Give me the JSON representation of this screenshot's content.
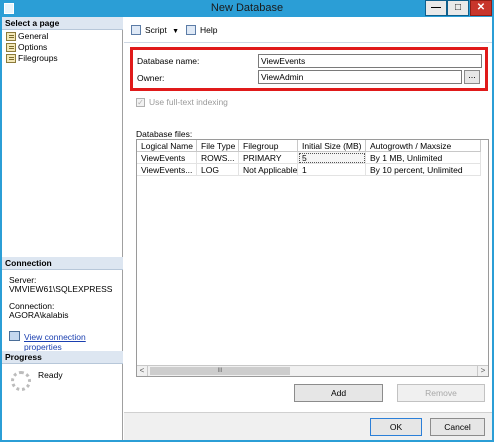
{
  "window": {
    "title": "New Database",
    "minimize_glyph": "—",
    "maximize_glyph": "□",
    "close_glyph": "✕"
  },
  "left_pane": {
    "select_page_header": "Select a page",
    "pages": [
      {
        "label": "General",
        "icon": "page-icon"
      },
      {
        "label": "Options",
        "icon": "page-icon"
      },
      {
        "label": "Filegroups",
        "icon": "page-icon"
      }
    ],
    "connection_header": "Connection",
    "server_label": "Server:",
    "server_value": "VMVIEW61\\SQLEXPRESS",
    "connection_label": "Connection:",
    "connection_value": "AGORA\\kalabis",
    "view_connection_link": "View connection properties",
    "progress_header": "Progress",
    "progress_status": "Ready"
  },
  "toolbar": {
    "script_label": "Script",
    "dropdown_arrow": "▼",
    "help_label": "Help"
  },
  "form": {
    "db_name_label": "Database name:",
    "db_name_value": "ViewEvents",
    "owner_label": "Owner:",
    "owner_value": "ViewAdmin",
    "browse_label": "...",
    "fulltext_label": "Use full-text indexing",
    "fulltext_checked": true,
    "checkmark": "✓"
  },
  "database_files": {
    "label": "Database files:",
    "columns": [
      "Logical Name",
      "File Type",
      "Filegroup",
      "Initial Size (MB)",
      "Autogrowth / Maxsize"
    ],
    "rows": [
      [
        "ViewEvents",
        "ROWS...",
        "PRIMARY",
        "5",
        "By 1 MB, Unlimited"
      ],
      [
        "ViewEvents...",
        "LOG",
        "Not Applicable",
        "1",
        "By 10 percent, Unlimited"
      ]
    ],
    "scroll_left": "<",
    "scroll_right": ">",
    "scroll_thumb": "III"
  },
  "buttons": {
    "add": "Add",
    "remove": "Remove",
    "ok": "OK",
    "cancel": "Cancel"
  },
  "colors": {
    "title_bar": "#2b9ed6",
    "highlight_border": "#e01a1a",
    "section_header": "#dde6f1",
    "link": "#1a3fb0"
  }
}
